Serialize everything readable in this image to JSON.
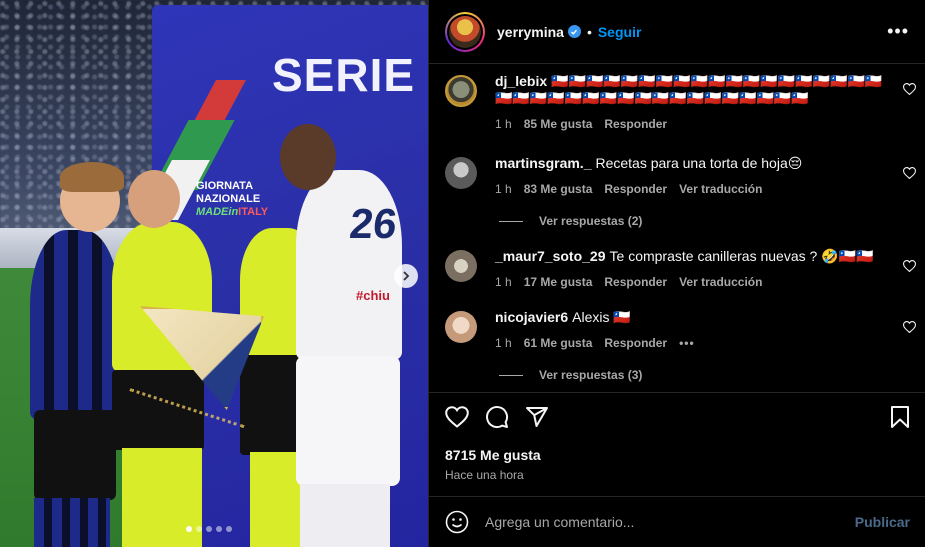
{
  "post": {
    "username": "yerrymina",
    "verified": true,
    "follow_label": "Seguir",
    "bullet": "•",
    "more_label": "•••"
  },
  "photo": {
    "board_text": "SERIE",
    "giornata_1": "GIORNATA",
    "giornata_2": "NAZIONALE",
    "made_in": "MADE",
    "in_italy": "in",
    "italy": "ITALY",
    "player_number": "26",
    "shirt_sponsor": "#chiu",
    "carousel_dots": 5,
    "active_dot": 0
  },
  "comments": [
    {
      "username": "dj_lebix",
      "text": "🇨🇱🇨🇱🇨🇱🇨🇱🇨🇱🇨🇱🇨🇱🇨🇱🇨🇱🇨🇱🇨🇱🇨🇱🇨🇱🇨🇱🇨🇱🇨🇱🇨🇱🇨🇱🇨🇱🇨🇱🇨🇱🇨🇱🇨🇱🇨🇱🇨🇱🇨🇱🇨🇱🇨🇱🇨🇱🇨🇱🇨🇱🇨🇱🇨🇱🇨🇱🇨🇱🇨🇱🇨🇱",
      "time": "1 h",
      "likes": "85 Me gusta",
      "reply": "Responder",
      "translate": "",
      "avatar_color": "#7a6a5a"
    },
    {
      "username": "martinsgram._",
      "text": "Recetas para una torta de hoja😔",
      "time": "1 h",
      "likes": "83 Me gusta",
      "reply": "Responder",
      "translate": "Ver traducción",
      "view_replies": "Ver respuestas (2)",
      "avatar_color": "#6b6b6b"
    },
    {
      "username": "_maur7_soto_29",
      "text": "Te compraste canilleras nuevas ? 🤣🇨🇱🇨🇱",
      "time": "1 h",
      "likes": "17 Me gusta",
      "reply": "Responder",
      "translate": "Ver traducción",
      "avatar_color": "#8a7f6e"
    },
    {
      "username": "nicojavier6",
      "text": "Alexis 🇨🇱",
      "time": "1 h",
      "likes": "61 Me gusta",
      "reply": "Responder",
      "translate": "",
      "more": "•••",
      "view_replies": "Ver respuestas (3)",
      "avatar_color": "#c9a58a"
    }
  ],
  "actions": {
    "likes_count": "8715 Me gusta",
    "posted_time": "Hace una hora"
  },
  "add_comment": {
    "placeholder": "Agrega un comentario...",
    "publish_label": "Publicar"
  },
  "colors": {
    "link_blue": "#0095f6",
    "verified_blue": "#3897f0",
    "muted_text": "#a8a8a8",
    "background": "#000000"
  }
}
